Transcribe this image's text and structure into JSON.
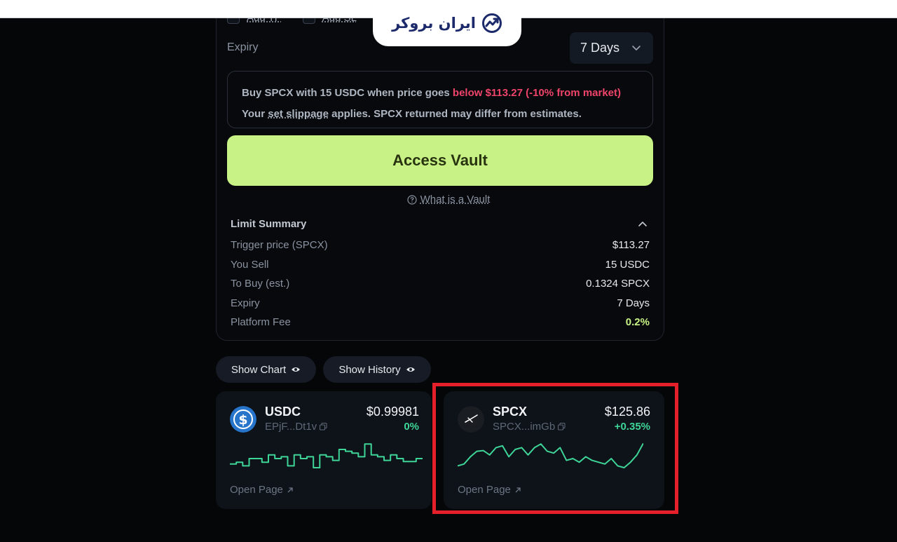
{
  "logo": {
    "text": "ایران بروکر"
  },
  "options": {
    "add_tp": "Add TP",
    "add_sl": "Add SL"
  },
  "expiry": {
    "label": "Expiry",
    "value": "7 Days"
  },
  "notice": {
    "line1_prefix": "Buy SPCX with 15 USDC when price goes ",
    "line1_warning": "below $113.27 (-10% from market)",
    "line2_prefix": "Your ",
    "line2_link": "set slippage",
    "line2_suffix": " applies. SPCX returned may differ from estimates."
  },
  "access_button": "Access Vault",
  "vault_link": "What is a Vault",
  "summary": {
    "title": "Limit Summary",
    "rows": [
      {
        "label": "Trigger price (SPCX)",
        "value": "$113.27"
      },
      {
        "label": "You Sell",
        "value": "15 USDC"
      },
      {
        "label": "To Buy (est.)",
        "value": "0.1324 SPCX"
      },
      {
        "label": "Expiry",
        "value": "7 Days"
      },
      {
        "label": "Platform Fee",
        "value": "0.2%"
      }
    ]
  },
  "toggles": {
    "show_chart": "Show Chart",
    "show_history": "Show History"
  },
  "cards": [
    {
      "symbol": "USDC",
      "address": "EPjF...Dt1v",
      "price": "$0.99981",
      "change": "0%",
      "open": "Open Page",
      "spark": [
        0.35,
        0.4,
        0.3,
        0.5,
        0.5,
        0.4,
        0.6,
        0.5,
        0.55,
        0.3,
        0.6,
        0.5,
        0.55,
        0.25,
        0.6,
        0.55,
        0.45,
        0.75,
        0.7,
        0.65,
        0.55,
        0.9,
        0.6,
        0.55,
        0.45,
        0.6,
        0.5,
        0.42,
        0.42,
        0.5
      ]
    },
    {
      "symbol": "SPCX",
      "address": "SPCX...imGb",
      "price": "$125.86",
      "change": "+0.35%",
      "open": "Open Page",
      "spark": [
        0.3,
        0.35,
        0.55,
        0.7,
        0.72,
        0.6,
        0.8,
        0.85,
        0.55,
        0.75,
        0.8,
        0.6,
        0.8,
        0.9,
        0.7,
        0.65,
        0.8,
        0.45,
        0.5,
        0.4,
        0.55,
        0.45,
        0.4,
        0.35,
        0.5,
        0.3,
        0.25,
        0.4,
        0.6,
        0.92
      ]
    }
  ],
  "colors": {
    "accent": "#c8f285",
    "warning": "#f0446b",
    "positive": "#3ed598",
    "highlight": "#e5202b"
  }
}
